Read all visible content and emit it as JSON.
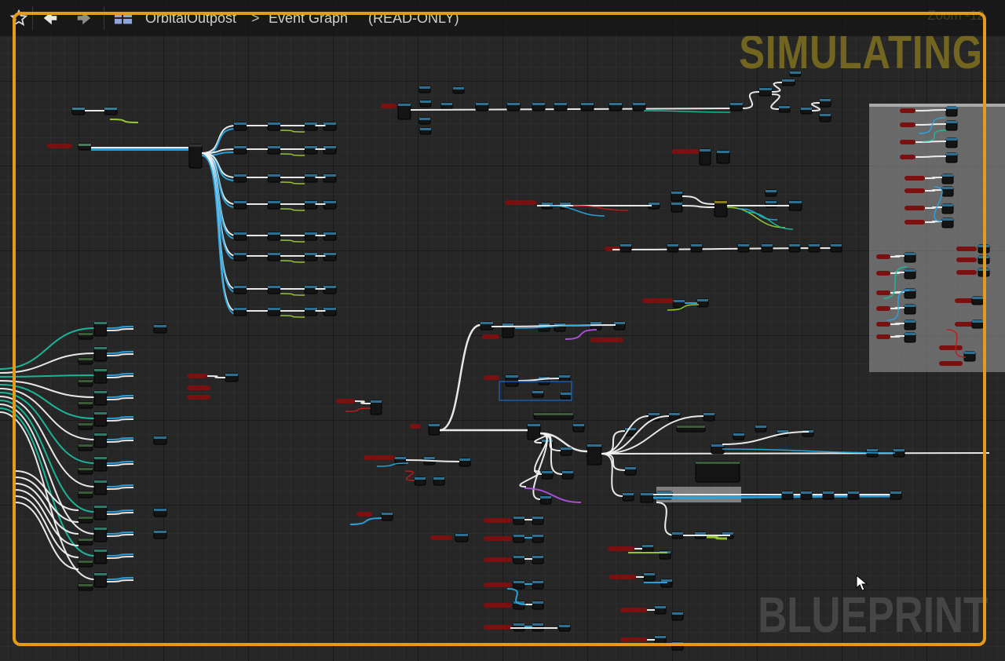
{
  "toolbar": {
    "favorite_icon": "star-outline-icon",
    "back_icon": "arrow-left-icon",
    "forward_icon": "arrow-right-icon",
    "graph_icon": "blueprint-graph-icon",
    "breadcrumb_project": "OrbitalOutpost",
    "breadcrumb_separator": ">",
    "breadcrumb_graph": "Event Graph",
    "mode": "(READ-ONLY)",
    "zoom_text": "Zoom -12"
  },
  "overlay": {
    "simulating_text": "SIMULATING",
    "watermark_text": "BLUEPRINT",
    "simulating_color": "#e69a1b"
  },
  "colors": {
    "exec_wire": "#f2f2f2",
    "object_wire": "#2aa4e0",
    "float_wire": "#9acd32",
    "struct_wire": "#1abc9c",
    "bool_wire": "#c01c1c",
    "function_wire": "#b050e0",
    "node_header_red": "#7a1010",
    "node_body": "#141414"
  }
}
